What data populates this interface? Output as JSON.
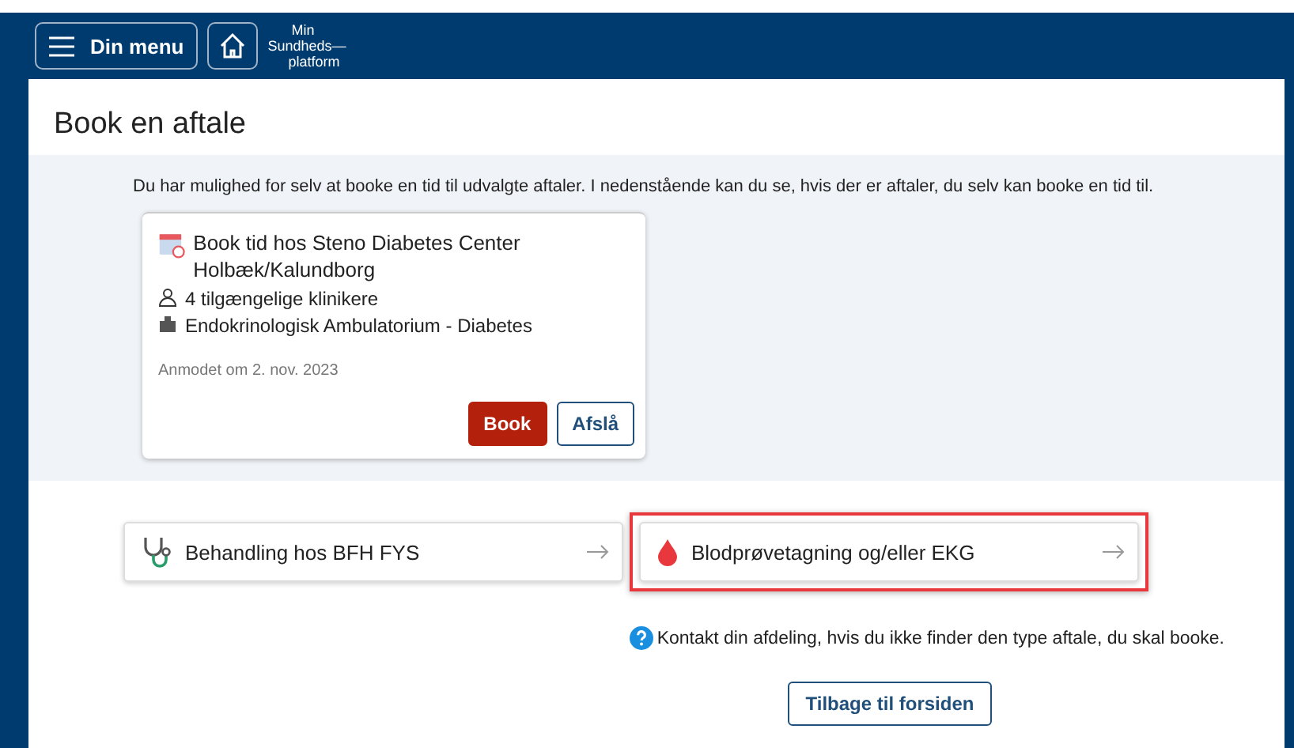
{
  "header": {
    "menu_button": "Din menu",
    "logo": [
      "Min",
      "Sundheds—",
      "platform"
    ]
  },
  "page": {
    "title": "Book en aftale",
    "intro": "Du har mulighed for selv at booke en tid til udvalgte aftaler. I nedenstående kan du se, hvis der er aftaler, du selv kan booke en tid til."
  },
  "request_card": {
    "title": "Book tid hos Steno Diabetes Center Holbæk/Kalundborg",
    "details": [
      {
        "kind": "clinicians",
        "text": "4 tilgængelige klinikere"
      },
      {
        "kind": "department",
        "text": "Endokrinologisk Ambulatorium - Diabetes"
      }
    ],
    "requested": "Anmodet om 2. nov. 2023",
    "buttons": [
      {
        "label": "Book",
        "kind": "primary"
      },
      {
        "label": "Afslå",
        "kind": "secondary"
      }
    ]
  },
  "options": [
    {
      "label": "Behandling hos BFH FYS",
      "kind": "stethoscope",
      "highlighted": false
    },
    {
      "label": "Blodprøvetagning og/eller EKG",
      "kind": "blood",
      "highlighted": true
    }
  ],
  "help_text": "Kontakt din afdeling, hvis du ikke finder den type aftale, du skal booke.",
  "back_button": "Tilbage til forsiden"
}
